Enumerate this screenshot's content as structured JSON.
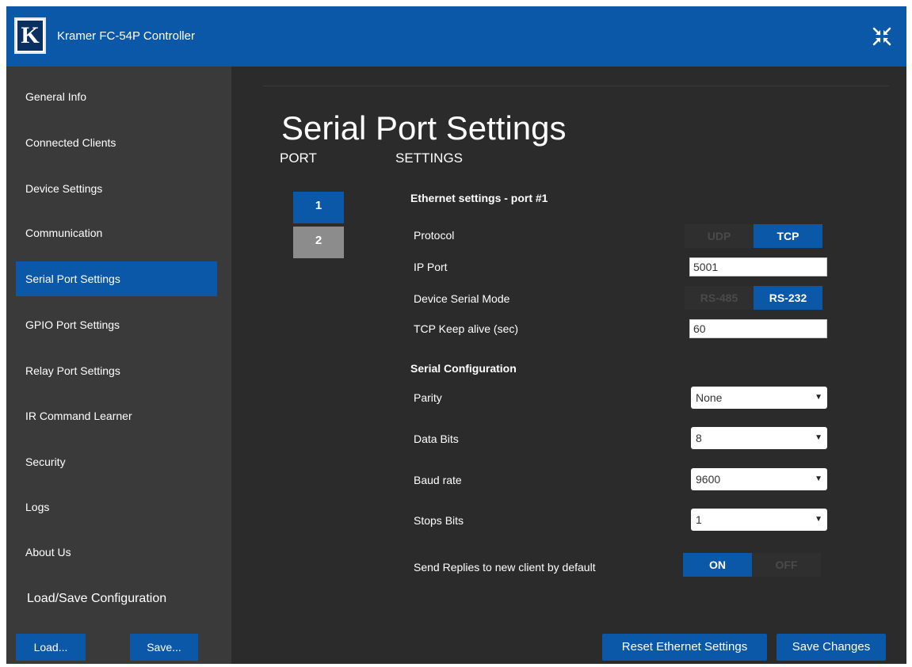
{
  "header": {
    "logo_text": "K",
    "app_title": "Kramer FC-54P Controller",
    "collapse_icon": "collapse-arrows-icon"
  },
  "sidebar": {
    "items": [
      {
        "label": "General Info",
        "active": false
      },
      {
        "label": "Connected Clients",
        "active": false
      },
      {
        "label": "Device Settings",
        "active": false
      },
      {
        "label": "Communication",
        "active": false
      },
      {
        "label": "Serial Port Settings",
        "active": true
      },
      {
        "label": "GPIO Port Settings",
        "active": false
      },
      {
        "label": "Relay Port Settings",
        "active": false
      },
      {
        "label": "IR Command Learner",
        "active": false
      },
      {
        "label": "Security",
        "active": false
      },
      {
        "label": "Logs",
        "active": false
      },
      {
        "label": "About Us",
        "active": false
      }
    ],
    "config_title": "Load/Save Configuration",
    "load_label": "Load...",
    "save_label": "Save..."
  },
  "main": {
    "title": "Serial Port Settings",
    "port_header": "PORT",
    "settings_header": "SETTINGS",
    "ports": [
      {
        "label": "1",
        "selected": true
      },
      {
        "label": "2",
        "selected": false
      }
    ],
    "ethernet": {
      "title": "Ethernet settings - port #1",
      "protocol_label": "Protocol",
      "protocol_options": [
        "UDP",
        "TCP"
      ],
      "protocol_selected": "TCP",
      "ip_port_label": "IP Port",
      "ip_port_value": "5001",
      "serial_mode_label": "Device Serial Mode",
      "serial_mode_options": [
        "RS-485",
        "RS-232"
      ],
      "serial_mode_selected": "RS-232",
      "keepalive_label": "TCP Keep alive (sec)",
      "keepalive_value": "60"
    },
    "serial": {
      "title": "Serial Configuration",
      "parity_label": "Parity",
      "parity_value": "None",
      "data_bits_label": "Data Bits",
      "data_bits_value": "8",
      "baud_label": "Baud rate",
      "baud_value": "9600",
      "stop_bits_label": "Stops Bits",
      "stop_bits_value": "1",
      "replies_label": "Send Replies to new client by default",
      "replies_options": [
        "ON",
        "OFF"
      ],
      "replies_selected": "ON"
    },
    "reset_label": "Reset Ethernet Settings",
    "save_changes_label": "Save Changes"
  },
  "colors": {
    "accent": "#0b57a8",
    "sidebar_bg": "#3a3a3a",
    "main_bg": "#2b2b2b",
    "port_inactive": "#8c8c8c"
  }
}
